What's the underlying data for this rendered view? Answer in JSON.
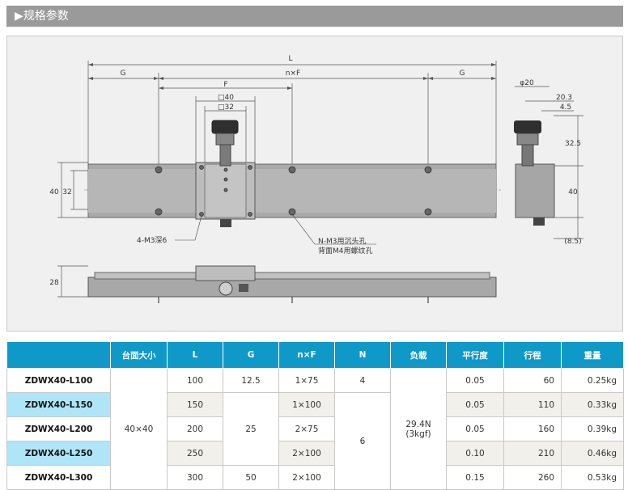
{
  "section_title": "▶规格参数",
  "drawing": {
    "dim_L": "L",
    "dim_G_left": "G",
    "dim_nF": "n×F",
    "dim_G_right": "G",
    "dim_F": "F",
    "dim_sq40": "□40",
    "dim_sq32": "□32",
    "dim_40": "40",
    "dim_32": "32",
    "dim_28": "28",
    "dim_phi20": "φ20",
    "dim_20_3": "20.3",
    "dim_4_5": "4.5",
    "dim_32_5": "32.5",
    "dim_40_side": "40",
    "dim_8_5": "(8.5)",
    "note_holes_left": "4-M3深6",
    "note_holes_right_1": "N-M3用沉头孔",
    "note_holes_right_2": "背面M4用螺纹孔"
  },
  "table": {
    "headers": [
      "",
      "台面大小",
      "L",
      "G",
      "n×F",
      "N",
      "负载",
      "平行度",
      "行程",
      "重量"
    ],
    "table_size": "40×40",
    "load": "29.4N",
    "load_kgf": "(3kgf)",
    "g_merged": "25",
    "n_first": "4",
    "n_merged": "6",
    "rows": [
      {
        "model": "ZDWX40-L100",
        "L": "100",
        "G": "12.5",
        "nF": "1×75",
        "parallel": "0.05",
        "stroke": "60",
        "weight": "0.25kg"
      },
      {
        "model": "ZDWX40-L150",
        "L": "150",
        "G": "",
        "nF": "1×100",
        "parallel": "0.05",
        "stroke": "110",
        "weight": "0.33kg"
      },
      {
        "model": "ZDWX40-L200",
        "L": "200",
        "G": "",
        "nF": "2×75",
        "parallel": "0.05",
        "stroke": "160",
        "weight": "0.39kg"
      },
      {
        "model": "ZDWX40-L250",
        "L": "250",
        "G": "",
        "nF": "2×100",
        "parallel": "0.10",
        "stroke": "210",
        "weight": "0.46kg"
      },
      {
        "model": "ZDWX40-L300",
        "L": "300",
        "G": "50",
        "nF": "2×100",
        "parallel": "0.15",
        "stroke": "260",
        "weight": "0.53kg"
      }
    ]
  }
}
